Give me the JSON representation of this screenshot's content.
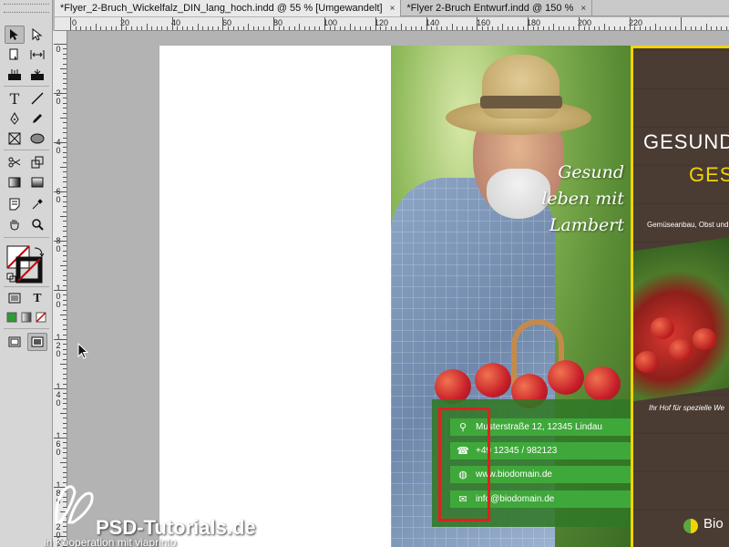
{
  "tabs": [
    {
      "label": "*Flyer_2-Bruch_Wickelfalz_DIN_lang_hoch.indd @ 55 % [Umgewandelt]",
      "close": "×",
      "active": true
    },
    {
      "label": "*Flyer 2-Bruch Entwurf.indd @ 150 %",
      "close": "×",
      "active": false
    }
  ],
  "ruler_h": [
    "0",
    "20",
    "40",
    "60",
    "80",
    "100",
    "120",
    "140",
    "160",
    "180",
    "200",
    "220"
  ],
  "ruler_v": [
    "0",
    "2 0",
    "4 0",
    "6 0",
    "8 0",
    "1 0 0",
    "1 2 0",
    "1 4 0",
    "1 6 0",
    "1 8 0",
    "2 0 0"
  ],
  "tools": {
    "type_glyph": "T",
    "fill_text_glyph": "T"
  },
  "flyer": {
    "script_lines": [
      "Gesund",
      "leben mit",
      "Lambert"
    ],
    "contacts": [
      {
        "icon": "location-pin-icon",
        "glyph": "⚲",
        "text": "Musterstraße 12, 12345 Lindau"
      },
      {
        "icon": "phone-icon",
        "glyph": "☎",
        "text": "+49 12345 / 982123"
      },
      {
        "icon": "globe-icon",
        "glyph": "◍",
        "text": "www.biodomain.de"
      },
      {
        "icon": "mail-icon",
        "glyph": "✉",
        "text": "info@biodomain.de"
      }
    ],
    "headline_1": "GESUND",
    "headline_2": "GES",
    "subtext": "Gemüseanbau, Obst und",
    "slogan": "Ihr Hof für spezielle We",
    "brand": "Bio"
  },
  "colors": {
    "highlight_box": "#e1201c",
    "contact_bar": "#3fa83a",
    "accent_yellow": "#f1d400"
  },
  "watermark": {
    "title": "PSD-Tutorials.de",
    "subtitle": "in Kooperation mit  viaprinto"
  }
}
